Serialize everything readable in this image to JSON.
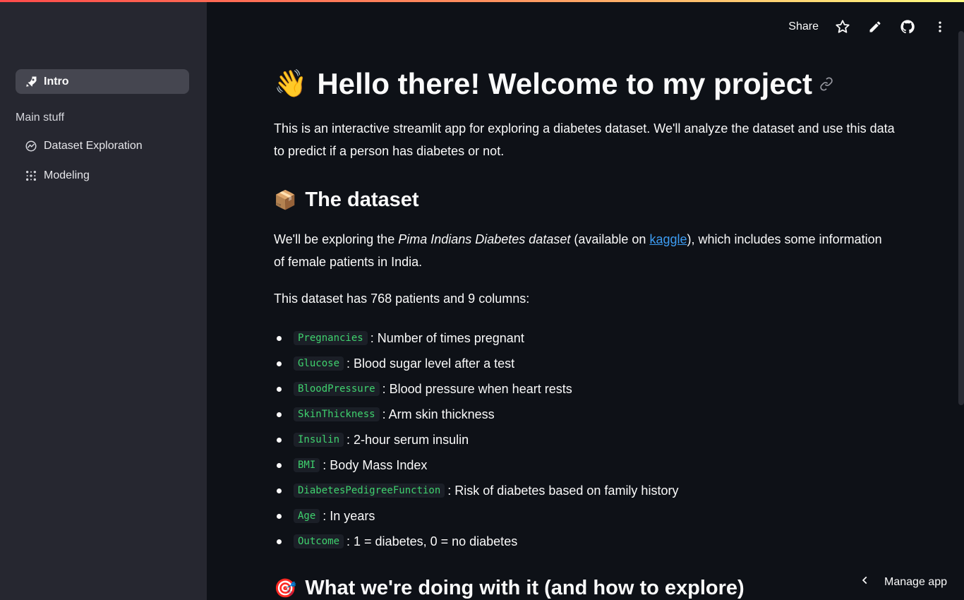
{
  "sidebar": {
    "items": [
      {
        "label": "Intro",
        "icon": "rocket-icon",
        "active": true
      },
      {
        "label": "Dataset Exploration",
        "icon": "chart-icon",
        "active": false
      },
      {
        "label": "Modeling",
        "icon": "dots-grid-icon",
        "active": false
      }
    ],
    "section_label": "Main stuff"
  },
  "header": {
    "share_label": "Share"
  },
  "main": {
    "title_emoji": "👋",
    "title": "Hello there! Welcome to my project",
    "intro": "This is an interactive streamlit app for exploring a diabetes dataset. We'll analyze the dataset and use this data to predict if a person has diabetes or not.",
    "dataset_emoji": "📦",
    "dataset_heading": "The dataset",
    "dataset_p_before": "We'll be exploring the ",
    "dataset_p_em": "Pima Indians Diabetes dataset",
    "dataset_p_mid": " (available on ",
    "dataset_p_link": "kaggle",
    "dataset_p_after": "), which includes some information of female patients in India.",
    "columns_intro": "This dataset has 768 patients and 9 columns:",
    "columns": [
      {
        "code": "Pregnancies",
        "desc": ": Number of times pregnant"
      },
      {
        "code": "Glucose",
        "desc": ": Blood sugar level after a test"
      },
      {
        "code": "BloodPressure",
        "desc": ": Blood pressure when heart rests"
      },
      {
        "code": "SkinThickness",
        "desc": ": Arm skin thickness"
      },
      {
        "code": "Insulin",
        "desc": ": 2-hour serum insulin"
      },
      {
        "code": "BMI",
        "desc": ": Body Mass Index"
      },
      {
        "code": "DiabetesPedigreeFunction",
        "desc": ": Risk of diabetes based on family history"
      },
      {
        "code": "Age",
        "desc": ": In years"
      },
      {
        "code": "Outcome",
        "desc": ": 1 = diabetes, 0 = no diabetes"
      }
    ],
    "next_emoji": "🎯",
    "next_heading": "What we're doing with it (and how to explore)"
  },
  "footer": {
    "manage_label": "Manage app"
  },
  "colors": {
    "accent_code": "#3fd26e",
    "link": "#3d9df3",
    "sidebar_bg": "#262730",
    "main_bg": "#0e1117"
  }
}
